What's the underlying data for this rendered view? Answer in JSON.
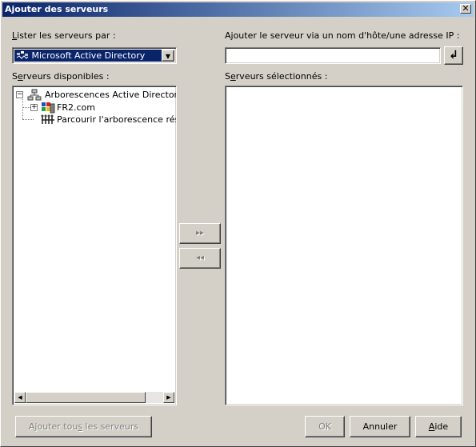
{
  "window": {
    "title": "Ajouter des serveurs",
    "close_glyph": "✕"
  },
  "list_by": {
    "label_prefix": "L",
    "label_rest": "ister les serveurs par :",
    "selected": "Microsoft Active Directory",
    "icon": "network-directory-icon",
    "arrow_glyph": "▼"
  },
  "add_host": {
    "label": "Ajouter le serveur via un nom d'hôte/une adresse IP :",
    "value": "",
    "enter_glyph": "↲"
  },
  "available": {
    "label_prefix": "S",
    "label_accel": "e",
    "label_rest": "rveurs disponibles :",
    "tree": [
      {
        "label": "Arborescences Active Directory",
        "icon": "tree-root-icon",
        "expander": "−"
      },
      {
        "label": "FR2.com",
        "icon": "domain-icon",
        "expander": "+"
      },
      {
        "label": "Parcourir l'arborescence réseau",
        "icon": "network-icon",
        "expander": ""
      }
    ],
    "scroll_left": "◀",
    "scroll_right": "▶"
  },
  "transfer": {
    "add_glyph": "▸▸",
    "remove_glyph": "◂◂"
  },
  "selected": {
    "label_prefix": "S",
    "label_accel": "e",
    "label_rest": "rveurs sélectionnés :"
  },
  "footer": {
    "add_all_prefix": "Ajouter tou",
    "add_all_accel": "s",
    "add_all_rest": " les serveurs",
    "ok": "OK",
    "cancel": "Annuler",
    "help_accel": "A",
    "help_rest": "ide"
  },
  "colors": {
    "face": "#d4d0c8",
    "title_start": "#0a246a",
    "title_end": "#a6caf0",
    "selection": "#0a246a"
  }
}
